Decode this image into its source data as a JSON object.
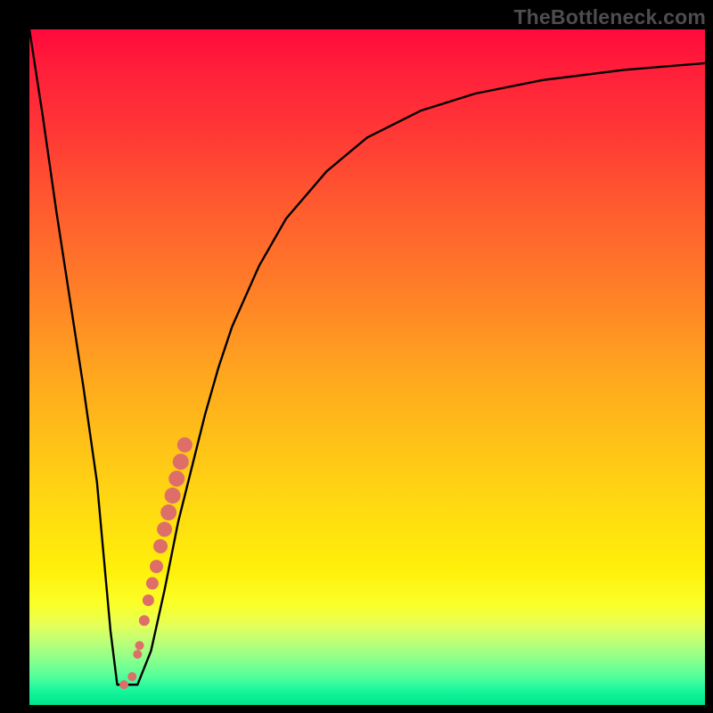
{
  "watermark": "TheBottleneck.com",
  "colors": {
    "background": "#000000",
    "curve_stroke": "#000000",
    "dot_fill": "#de6e68",
    "watermark": "#4d4d4d"
  },
  "chart_data": {
    "type": "line",
    "title": "",
    "xlabel": "",
    "ylabel": "",
    "xlim": [
      0,
      100
    ],
    "ylim": [
      0,
      100
    ],
    "grid": false,
    "legend": false,
    "series": [
      {
        "name": "bottleneck-curve",
        "x": [
          0,
          2,
          4,
          6,
          8,
          10,
          12,
          13,
          14,
          16,
          18,
          20,
          22,
          24,
          26,
          28,
          30,
          34,
          38,
          44,
          50,
          58,
          66,
          76,
          88,
          100
        ],
        "y": [
          100,
          87,
          73,
          60,
          47,
          33,
          11,
          3,
          3,
          3,
          8,
          17,
          27,
          35,
          43,
          50,
          56,
          65,
          72,
          79,
          84,
          88,
          90.5,
          92.5,
          94,
          95
        ]
      }
    ],
    "scatter": {
      "name": "highlight-dots",
      "points": [
        {
          "x": 14.0,
          "y": 3.0,
          "r": 5
        },
        {
          "x": 15.2,
          "y": 4.2,
          "r": 5
        },
        {
          "x": 16.0,
          "y": 7.5,
          "r": 5
        },
        {
          "x": 16.3,
          "y": 8.8,
          "r": 5
        },
        {
          "x": 17.0,
          "y": 12.5,
          "r": 6
        },
        {
          "x": 17.6,
          "y": 15.5,
          "r": 6.5
        },
        {
          "x": 18.2,
          "y": 18.0,
          "r": 7
        },
        {
          "x": 18.8,
          "y": 20.5,
          "r": 7.5
        },
        {
          "x": 19.4,
          "y": 23.5,
          "r": 8
        },
        {
          "x": 20.0,
          "y": 26.0,
          "r": 8.5
        },
        {
          "x": 20.6,
          "y": 28.5,
          "r": 9
        },
        {
          "x": 21.2,
          "y": 31.0,
          "r": 9
        },
        {
          "x": 21.8,
          "y": 33.5,
          "r": 9
        },
        {
          "x": 22.4,
          "y": 36.0,
          "r": 9
        },
        {
          "x": 23.0,
          "y": 38.5,
          "r": 8.5
        }
      ]
    }
  }
}
